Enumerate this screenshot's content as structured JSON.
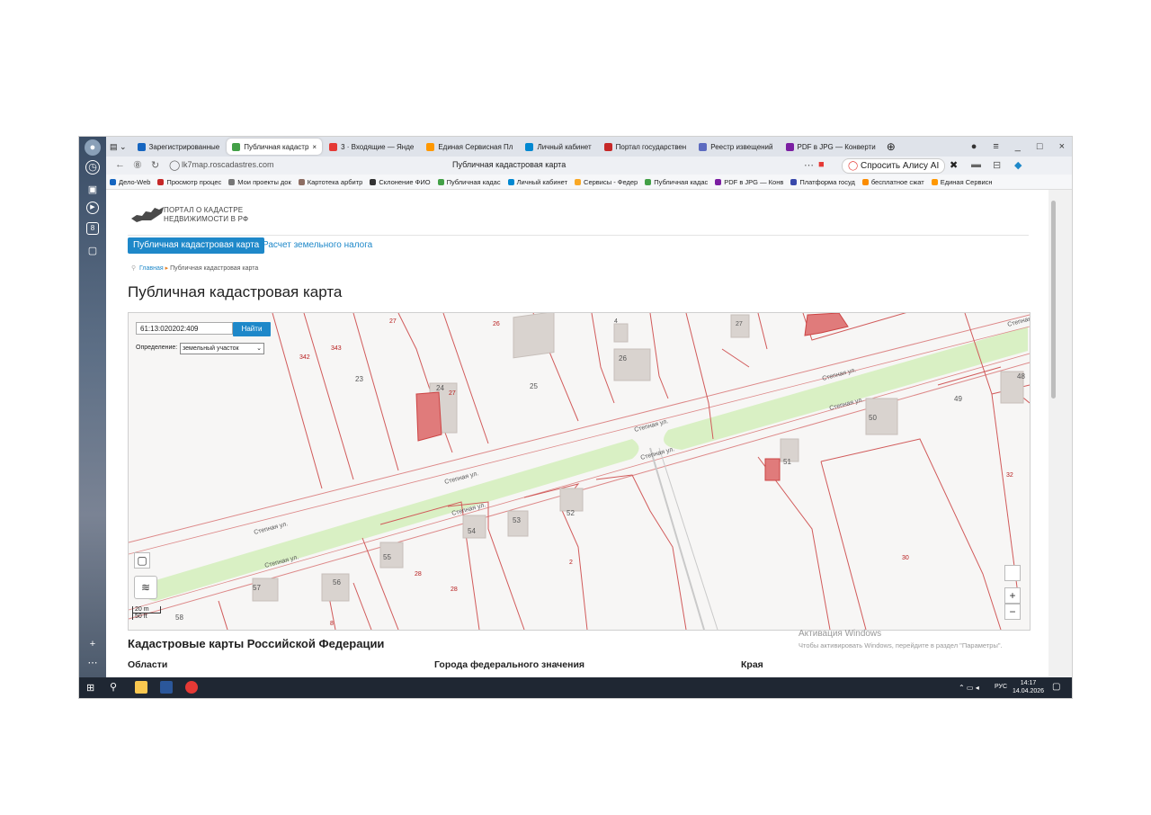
{
  "tabs": [
    {
      "label": "Зарегистрированные",
      "color": "#1565c0",
      "active": false
    },
    {
      "label": "Публичная кадастр",
      "color": "#43a047",
      "active": true
    },
    {
      "label": "3 · Входящие — Янде",
      "color": "#e53935",
      "active": false
    },
    {
      "label": "Единая Сервисная Пл",
      "color": "#ff9800",
      "active": false
    },
    {
      "label": "Личный кабинет",
      "color": "#0288d1",
      "active": false
    },
    {
      "label": "Портал государствен",
      "color": "#c62828",
      "active": false
    },
    {
      "label": "Реестр извещений",
      "color": "#5c6bc0",
      "active": false
    },
    {
      "label": "PDF в JPG — Конверти",
      "color": "#7b1fa2",
      "active": false
    }
  ],
  "address": {
    "url": "lk7map.roscadastres.com",
    "page_title": "Публичная кадастровая карта",
    "alice": "Спросить Алису AI"
  },
  "bookmarks": [
    {
      "label": "Дело-Web",
      "color": "#1565c0"
    },
    {
      "label": "Просмотр процес",
      "color": "#c62828"
    },
    {
      "label": "Мои проекты док",
      "color": "#777777"
    },
    {
      "label": "Картотека арбитр",
      "color": "#8d6e63"
    },
    {
      "label": "Склонение ФИО",
      "color": "#333333"
    },
    {
      "label": "Публичная кадас",
      "color": "#43a047"
    },
    {
      "label": "Личный кабинет",
      "color": "#0288d1"
    },
    {
      "label": "Сервисы - Федер",
      "color": "#f9a825"
    },
    {
      "label": "Публичная кадас",
      "color": "#43a047"
    },
    {
      "label": "PDF в JPG — Конв",
      "color": "#7b1fa2"
    },
    {
      "label": "Платформа госуд",
      "color": "#3949ab"
    },
    {
      "label": "бесплатное сжат",
      "color": "#fb8c00"
    },
    {
      "label": "Единая Сервисн",
      "color": "#ff9800"
    }
  ],
  "portal": {
    "line1": "ПОРТАЛ О КАДАСТРЕ",
    "line2": "НЕДВИЖИМОСТИ В РФ"
  },
  "nav": {
    "active": "Публичная кадастровая карта",
    "second": "Расчет земельного налога"
  },
  "breadcrumb": {
    "home": "Главная",
    "current": "Публичная кадастровая карта"
  },
  "heading": "Публичная кадастровая карта",
  "map": {
    "search_value": "61:13:020202:409",
    "find_label": "Найти",
    "def_label": "Определение:",
    "def_value": "земельный участок",
    "scale_m": "20 m",
    "scale_ft": "50 ft",
    "street": "Степная ул.",
    "plot_labels": [
      "27",
      "26",
      "4",
      "27",
      "343",
      "342",
      "23",
      "27",
      "24",
      "25",
      "26",
      "50",
      "49",
      "48",
      "51",
      "32",
      "53",
      "52",
      "54",
      "55",
      "56",
      "57",
      "58",
      "28",
      "28",
      "2",
      "8",
      "30"
    ]
  },
  "section_heading": "Кадастровые карты Российской Федерации",
  "columns": [
    "Области",
    "Города федерального значения",
    "Края"
  ],
  "watermark": {
    "title": "Активация Windows",
    "text": "Чтобы активировать Windows, перейдите в раздел \"Параметры\"."
  },
  "taskbar": {
    "lang": "РУС",
    "time": "14:17",
    "date": "14.04.2026"
  }
}
